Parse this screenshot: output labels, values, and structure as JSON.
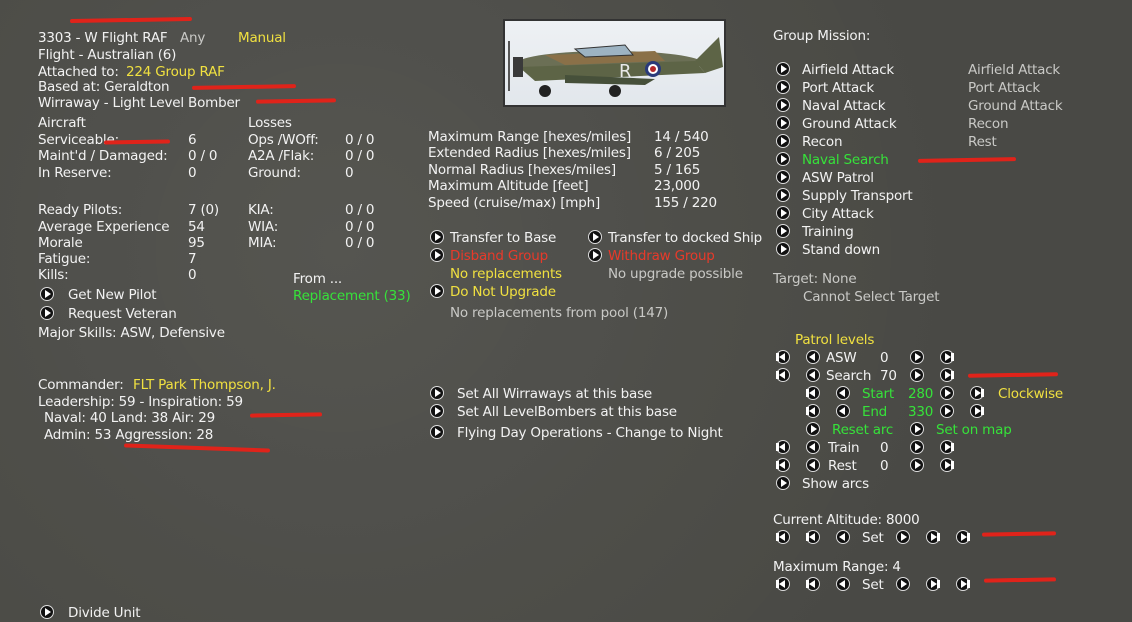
{
  "unit": {
    "id_name": "3303 - W Flight RAF",
    "any": "Any",
    "mode": "Manual",
    "flight": "Flight - Australian (6)",
    "attached_label": "Attached to:",
    "attached_value": "224 Group RAF",
    "based_at": "Based at:  Geraldton",
    "aircraft_type": "Wirraway - Light Level Bomber"
  },
  "aircraft": {
    "header": "Aircraft",
    "serviceable_label": "Serviceable:",
    "serviceable_value": "6",
    "maintd_label": "Maint'd / Damaged:",
    "maintd_value": "0 / 0",
    "reserve_label": "In Reserve:",
    "reserve_value": "0"
  },
  "losses": {
    "header": "Losses",
    "ops_label": "Ops /WOff:",
    "ops_value": "0 / 0",
    "a2a_label": "A2A /Flak:",
    "a2a_value": "0 / 0",
    "ground_label": "Ground:",
    "ground_value": "0"
  },
  "pilots": {
    "ready_label": "Ready Pilots:",
    "ready_value": "7 (0)",
    "exp_label": "Average Experience",
    "exp_value": "54",
    "morale_label": "Morale",
    "morale_value": "95",
    "fatigue_label": "Fatigue:",
    "fatigue_value": "7",
    "kills_label": "Kills:",
    "kills_value": "0",
    "kia_label": "KIA:",
    "kia_value": "0 / 0",
    "wia_label": "WIA:",
    "wia_value": "0 / 0",
    "mia_label": "MIA:",
    "mia_value": "0 / 0",
    "get_new_pilot": "Get New Pilot",
    "request_veteran": "Request Veteran",
    "major_skills": "Major Skills: ASW, Defensive",
    "from_label": "From ...",
    "replacement": "Replacement (33)"
  },
  "commander": {
    "label": "Commander:",
    "name": "FLT Park Thompson, J.",
    "leadership": "Leadership: 59 - Inspiration: 59",
    "skills": "Naval: 40  Land: 38  Air: 29",
    "admin": "Admin: 53  Aggression: 28"
  },
  "ranges": {
    "max_range_label": "Maximum Range [hexes/miles]",
    "max_range_value": "14 / 540",
    "ext_radius_label": "Extended Radius [hexes/miles]",
    "ext_radius_value": "6 / 205",
    "norm_radius_label": "Normal Radius [hexes/miles]",
    "norm_radius_value": "5 / 165",
    "max_alt_label": "Maximum Altitude [feet]",
    "max_alt_value": "23,000",
    "speed_label": "Speed (cruise/max) [mph]",
    "speed_value": "155 / 220"
  },
  "actions": {
    "transfer_base": "Transfer to Base",
    "transfer_ship": "Transfer to docked Ship",
    "disband": "Disband Group",
    "withdraw": "Withdraw Group",
    "no_replacements": "No replacements",
    "no_upgrade": "No upgrade possible",
    "do_not_upgrade": "Do Not Upgrade",
    "no_repl_pool": "No replacements from pool (147)",
    "set_all_wirraways": "Set All Wirraways at this base",
    "set_all_levelbombers": "Set All LevelBombers at this base",
    "flying_day": "Flying Day Operations - Change to Night",
    "divide_unit": "Divide Unit"
  },
  "mission": {
    "header": "Group Mission:",
    "items": [
      {
        "label": "Airfield Attack"
      },
      {
        "label": "Port Attack"
      },
      {
        "label": "Naval Attack"
      },
      {
        "label": "Ground Attack"
      },
      {
        "label": "Recon"
      },
      {
        "label": "Naval Search"
      },
      {
        "label": "ASW Patrol"
      },
      {
        "label": "Supply Transport"
      },
      {
        "label": "City Attack"
      },
      {
        "label": "Training"
      },
      {
        "label": "Stand down"
      }
    ],
    "secondary": [
      "Airfield Attack",
      "Port Attack",
      "Ground Attack",
      "Recon",
      "Rest"
    ],
    "target": "Target: None",
    "cannot_select": "Cannot Select Target"
  },
  "patrol": {
    "header": "Patrol levels",
    "asw_label": "ASW",
    "asw_value": "0",
    "search_label": "Search",
    "search_value": "70",
    "start_label": "Start",
    "start_value": "280",
    "end_label": "End",
    "end_value": "330",
    "clockwise": "Clockwise",
    "reset_arc": "Reset arc",
    "set_on_map": "Set on map",
    "train_label": "Train",
    "train_value": "0",
    "rest_label": "Rest",
    "rest_value": "0",
    "show_arcs": "Show arcs"
  },
  "altitude": {
    "current_label": "Current Altitude: 8000",
    "set": "Set",
    "max_range_label": "Maximum Range: 4",
    "set2": "Set"
  },
  "plane_image": {
    "roundel_letter": "R",
    "colors": {
      "camo_green": "#5d6446",
      "camo_brown": "#8a7048",
      "roundel_red": "#b4282a",
      "roundel_blue": "#2a3a7a"
    }
  }
}
